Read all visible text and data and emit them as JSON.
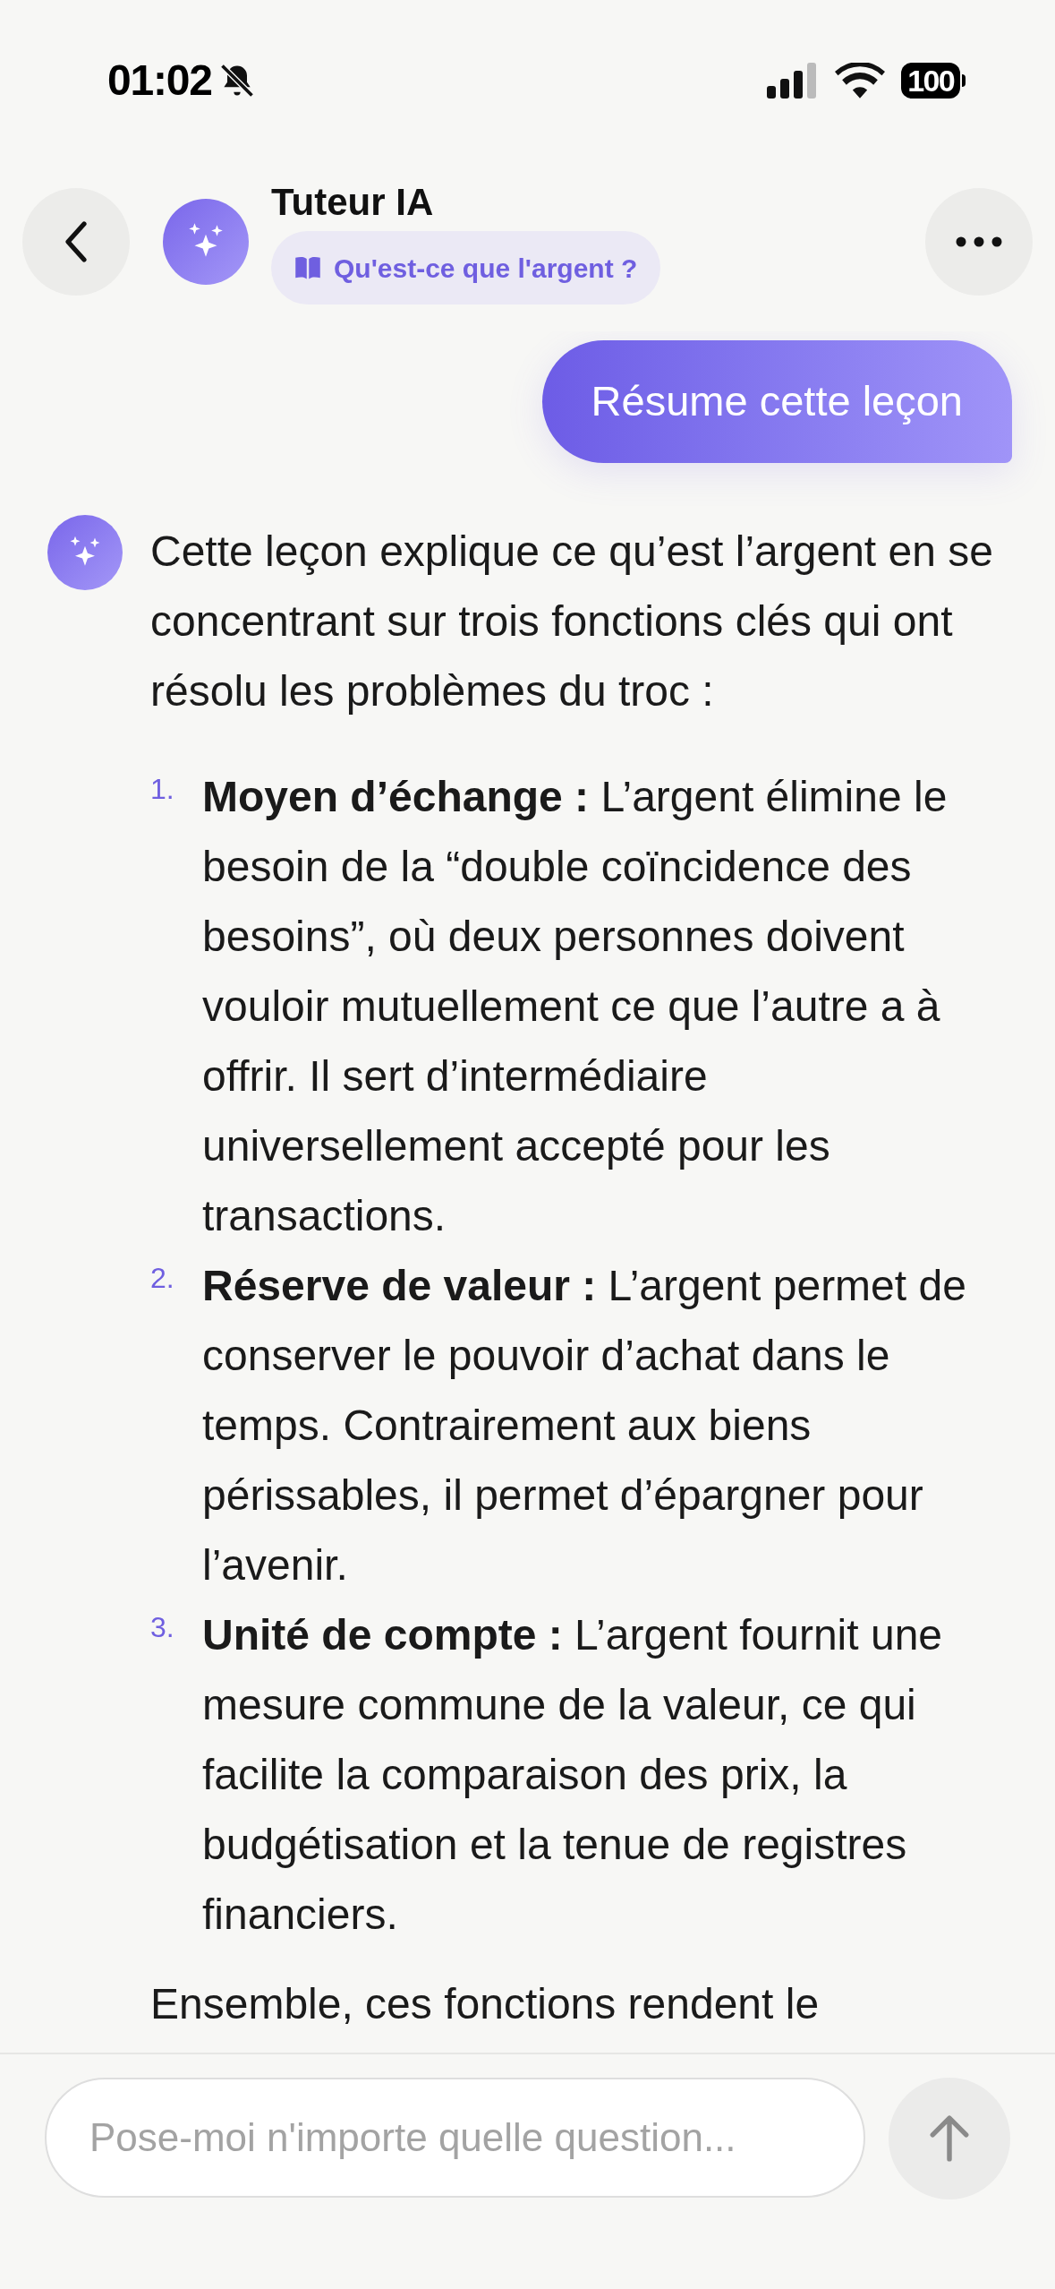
{
  "status_bar": {
    "time": "01:02",
    "battery": "100"
  },
  "header": {
    "title": "Tuteur IA",
    "lesson_chip": "Qu'est-ce que l'argent ?"
  },
  "messages": [
    {
      "kind": "user",
      "text": "Résume cette leçon"
    },
    {
      "kind": "assistant",
      "intro": "Cette leçon explique ce qu’est l’argent en se concentrant sur trois fonctions clés qui ont résolu les problèmes du troc :",
      "items": [
        {
          "number": "1.",
          "text": "**Moyen d’échange :** L’argent élimine le besoin de la “double coïncidence des besoins”, où deux personnes doivent vouloir mutuellement ce que l’autre a à offrir. Il sert d’intermédiaire universellement accepté pour les transactions."
        },
        {
          "number": "2.",
          "text": "**Réserve de valeur :** L’argent permet de conserver le pouvoir d’achat dans le temps. Contrairement aux biens périssables, il permet d’épargner pour l’avenir."
        },
        {
          "number": "3.",
          "text": "**Unité de compte :** L’argent fournit une mesure commune de la valeur, ce qui facilite la comparaison des prix, la budgétisation et la tenue de registres financiers."
        }
      ],
      "outro": "Ensemble, ces fonctions rendent le"
    }
  ],
  "composer": {
    "placeholder": "Pose-moi n'importe quelle question..."
  }
}
